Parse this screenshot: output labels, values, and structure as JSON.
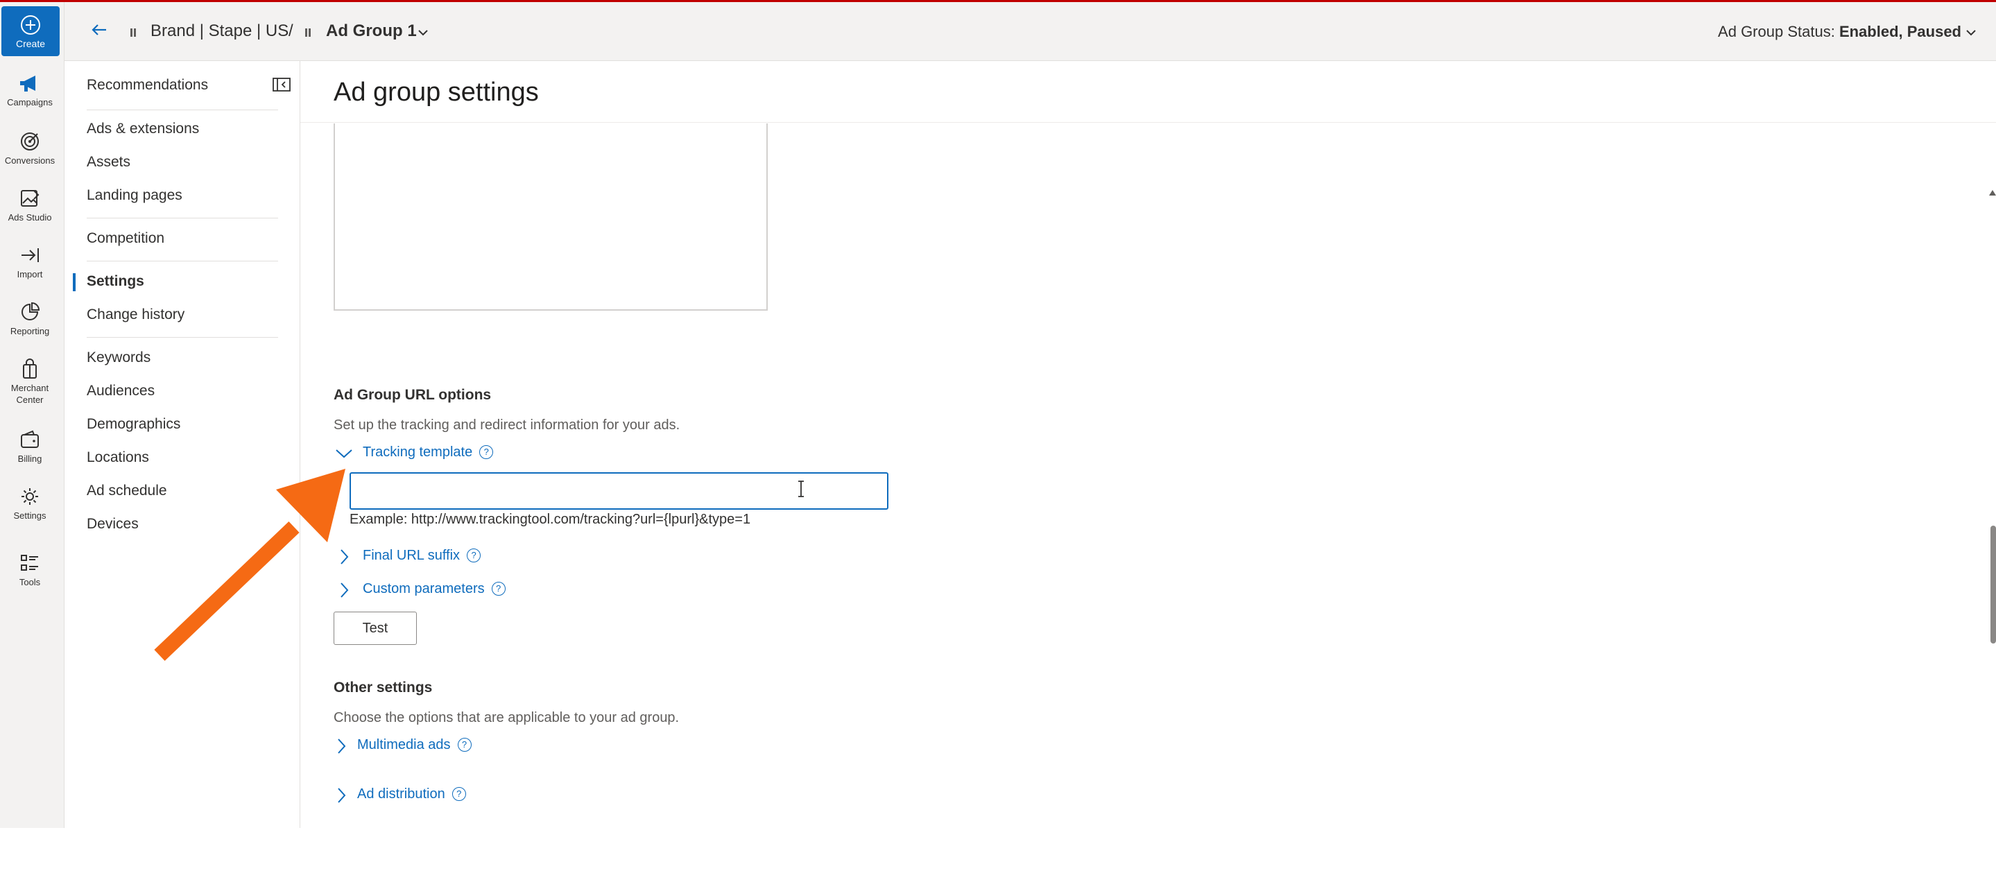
{
  "rail": {
    "create": "Create",
    "items": [
      {
        "label": "Campaigns",
        "icon": "megaphone-icon"
      },
      {
        "label": "Conversions",
        "icon": "target-icon"
      },
      {
        "label": "Ads Studio",
        "icon": "image-edit-icon"
      },
      {
        "label": "Import",
        "icon": "import-arrow-icon"
      },
      {
        "label": "Reporting",
        "icon": "chart-pie-icon"
      },
      {
        "label": "Merchant Center",
        "icon": "shopping-bag-icon"
      },
      {
        "label": "Billing",
        "icon": "wallet-icon"
      },
      {
        "label": "Settings",
        "icon": "gear-icon"
      },
      {
        "label": "Tools",
        "icon": "tools-list-icon"
      }
    ]
  },
  "header": {
    "breadcrumb_account": "Brand | Stape | US",
    "breadcrumb_separator": "/",
    "breadcrumb_adgroup": "Ad Group 1",
    "status_label": "Ad Group Status:",
    "status_value": "Enabled, Paused"
  },
  "subnav": {
    "recommendations": "Recommendations",
    "group1": [
      "Ads & extensions",
      "Assets",
      "Landing pages"
    ],
    "group2": [
      "Competition"
    ],
    "group3": [
      "Settings",
      "Change history"
    ],
    "group4": [
      "Keywords",
      "Audiences",
      "Demographics",
      "Locations",
      "Ad schedule",
      "Devices"
    ]
  },
  "main": {
    "title": "Ad group settings",
    "url_options": {
      "title": "Ad Group URL options",
      "description": "Set up the tracking and redirect information for your ads.",
      "tracking_template": "Tracking template",
      "tracking_value": "",
      "example": "Example: http://www.trackingtool.com/tracking?url={lpurl}&type=1",
      "final_url_suffix": "Final URL suffix",
      "custom_parameters": "Custom parameters",
      "test_button": "Test"
    },
    "other_settings": {
      "title": "Other settings",
      "description": "Choose the options that are applicable to your ad group.",
      "multimedia_ads": "Multimedia ads",
      "ad_distribution": "Ad distribution"
    }
  },
  "colors": {
    "accent": "#0f6cbd",
    "arrow": "#f56a14",
    "top_border": "#c00000"
  }
}
